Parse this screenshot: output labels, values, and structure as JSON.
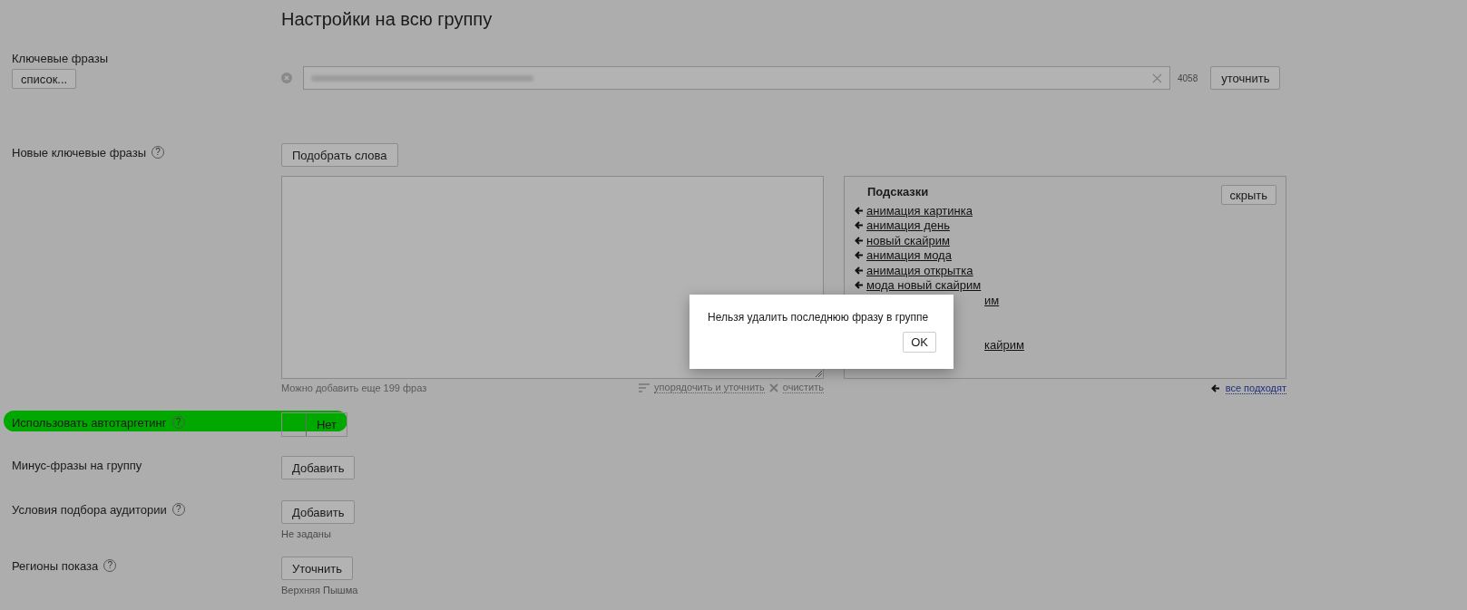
{
  "title": "Настройки на всю группу",
  "keywords": {
    "label": "Ключевые фразы",
    "list_button": "список...",
    "count": "4058",
    "refine_button": "уточнить"
  },
  "new_keywords": {
    "label": "Новые ключевые фразы",
    "help": "?",
    "pick_button": "Подобрать слова",
    "hint": "Можно добавить еще 199 фраз",
    "sort_link": "упорядочить и уточнить",
    "clear_link": "очистить"
  },
  "suggestions": {
    "title": "Подсказки",
    "hide_button": "скрыть",
    "all_link": "все подходят",
    "items": [
      {
        "text": "анимация картинка",
        "kind": "link"
      },
      {
        "text": "анимация день",
        "kind": "link"
      },
      {
        "text": "новый скайрим",
        "kind": "link"
      },
      {
        "text": "анимация мода",
        "kind": "link"
      },
      {
        "text": "анимация открытка",
        "kind": "link"
      },
      {
        "text": "мода новый скайрим",
        "kind": "link"
      },
      {
        "text": "им",
        "kind": "covered"
      },
      {
        "text": "кайрим",
        "kind": "covered"
      }
    ]
  },
  "autotargeting": {
    "label": "Использовать автотаргетинг",
    "help": "?",
    "toggle_label": "Нет",
    "on": false
  },
  "settings": [
    {
      "label": "Минус-фразы на группу",
      "button": "Добавить"
    },
    {
      "label": "Условия подбора аудитории",
      "help": "?",
      "button": "Добавить",
      "note": "Не заданы"
    },
    {
      "label": "Регионы показа",
      "help": "?",
      "button": "Уточнить",
      "note": "Верхняя Пышма"
    }
  ],
  "dialog": {
    "message": "Нельзя удалить последнюю фразу в группе",
    "ok_button": "OK"
  }
}
